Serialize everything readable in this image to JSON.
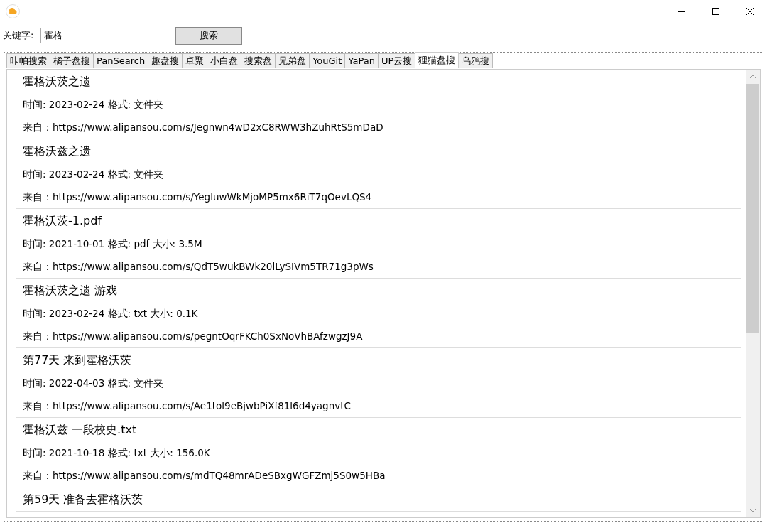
{
  "search": {
    "label": "关键字:",
    "value": "霍格",
    "button": "搜索"
  },
  "tabs": [
    {
      "label": "咔帕搜索",
      "selected": false
    },
    {
      "label": "橘子盘搜",
      "selected": false
    },
    {
      "label": "PanSearch",
      "selected": false
    },
    {
      "label": "趣盘搜",
      "selected": false
    },
    {
      "label": "卓聚",
      "selected": false
    },
    {
      "label": "小白盘",
      "selected": false
    },
    {
      "label": "搜索盘",
      "selected": false
    },
    {
      "label": "兄弟盘",
      "selected": false
    },
    {
      "label": "YouGit",
      "selected": false
    },
    {
      "label": "YaPan",
      "selected": false
    },
    {
      "label": "UP云搜",
      "selected": false
    },
    {
      "label": "狸猫盘搜",
      "selected": true
    },
    {
      "label": "乌鸦搜",
      "selected": false
    }
  ],
  "results": [
    {
      "title": "霍格沃茨之遗",
      "meta": "时间: 2023-02-24 格式: 文件夹",
      "source": "来自：https://www.alipansou.com/s/Jegnwn4wD2xC8RWW3hZuhRtS5mDaD"
    },
    {
      "title": "霍格沃兹之遗",
      "meta": "时间: 2023-02-24 格式: 文件夹",
      "source": "来自：https://www.alipansou.com/s/YegluwWkMjoMP5mx6RiT7qOevLQS4"
    },
    {
      "title": "霍格沃茨-1.pdf",
      "meta": "时间: 2021-10-01 格式: pdf 大小: 3.5M",
      "source": "来自：https://www.alipansou.com/s/QdT5wukBWk20lLySIVm5TR71g3pWs"
    },
    {
      "title": "霍格沃茨之遗 游戏",
      "meta": "时间: 2023-02-24 格式: txt 大小: 0.1K",
      "source": "来自：https://www.alipansou.com/s/pegntOqrFKCh0SxNoVhBAfzwgzJ9A"
    },
    {
      "title": "第77天 来到霍格沃茨",
      "meta": "时间: 2022-04-03 格式: 文件夹",
      "source": "来自：https://www.alipansou.com/s/Ae1tol9eBjwbPiXf81l6d4yagnvtC"
    },
    {
      "title": "霍格沃兹 一段校史.txt",
      "meta": "时间: 2021-10-18 格式: txt 大小: 156.0K",
      "source": "来自：https://www.alipansou.com/s/mdTQ48mrADeSBxgWGFZmj5S0w5HBa"
    },
    {
      "title": "第59天 准备去霍格沃茨"
    }
  ]
}
